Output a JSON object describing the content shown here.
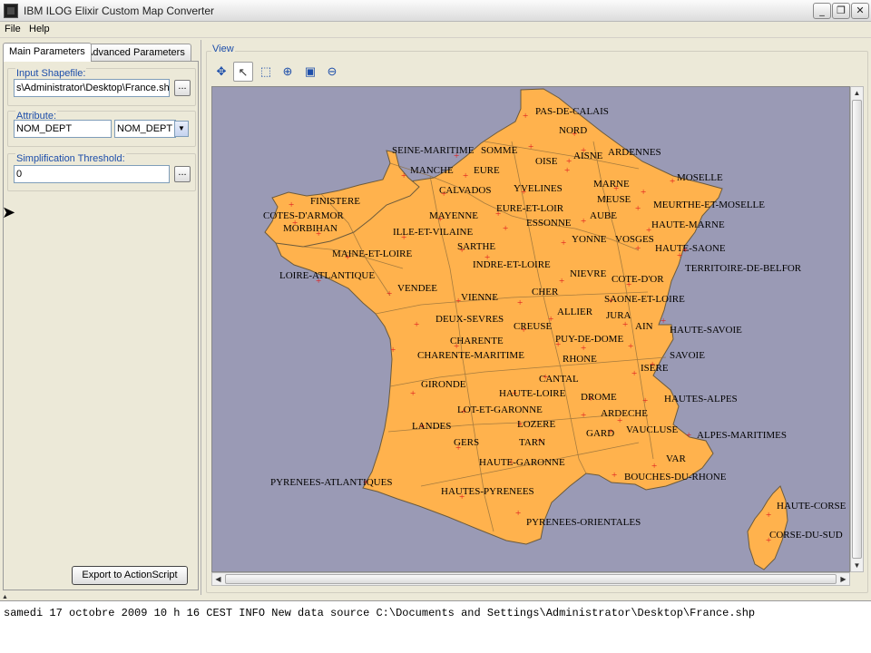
{
  "window": {
    "title": "IBM ILOG Elixir Custom Map Converter",
    "controls": {
      "minimize": "_",
      "maximize": "❐",
      "close": "✕"
    }
  },
  "menubar": {
    "items": [
      "File",
      "Help"
    ]
  },
  "left_panel": {
    "tabs": [
      "Main Parameters",
      "Advanced Parameters"
    ],
    "input_shapefile": {
      "label": "Input Shapefile:",
      "value": "s\\Administrator\\Desktop\\France.shp",
      "browse_label": "..."
    },
    "attribute": {
      "label": "Attribute:",
      "value": "NOM_DEPT",
      "selected_option": "NOM_DEPT"
    },
    "simplification": {
      "label": "Simplification Threshold:",
      "value": "0",
      "browse_label": "..."
    },
    "export_button": "Export to ActionScript"
  },
  "view": {
    "title": "View",
    "toolbar": [
      "pan-icon",
      "select-icon",
      "zoom-box-icon",
      "zoom-in-icon",
      "zoom-fit-icon",
      "zoom-out-icon"
    ],
    "map_colors": {
      "background": "#9a9ab5",
      "land": "#ffb24d",
      "border": "#6b5a3c",
      "marker": "#e02020"
    },
    "department_labels": [
      "PAS-DE-CALAIS",
      "NORD",
      "SOMME",
      "SEINE-MARITIME",
      "AISNE",
      "ARDENNES",
      "OISE",
      "MANCHE",
      "EURE",
      "YVELINES",
      "MARNE",
      "MOSELLE",
      "FINISTERE",
      "CALVADOS",
      "MEUSE",
      "MEURTHE-ET-MOSELLE",
      "COTES-D'ARMOR",
      "MAYENNE",
      "EURE-ET-LOIR",
      "AUBE",
      "HAUTE-MARNE",
      "MORBIHAN",
      "ILLE-ET-VILAINE",
      "ESSONNE",
      "YONNE",
      "VOSGES",
      "SARTHE",
      "HAUTE-SAONE",
      "MAINE-ET-LOIRE",
      "INDRE-ET-LOIRE",
      "TERRITOIRE-DE-BELFOR",
      "LOIRE-ATLANTIQUE",
      "NIEVRE",
      "COTE-D'OR",
      "VENDEE",
      "VIENNE",
      "CHER",
      "SAONE-ET-LOIRE",
      "ALLIER",
      "JURA",
      "DEUX-SEVRES",
      "CREUSE",
      "AIN",
      "HAUTE-SAVOIE",
      "CHARENTE",
      "PUY-DE-DOME",
      "CHARENTE-MARITIME",
      "SAVOIE",
      "RHONE",
      "ISERE",
      "CANTAL",
      "GIRONDE",
      "HAUTE-LOIRE",
      "DROME",
      "HAUTES-ALPES",
      "LOT-ET-GARONNE",
      "ARDECHE",
      "LANDES",
      "LOZERE",
      "VAUCLUSE",
      "ALPES-MARITIMES",
      "GARD",
      "GERS",
      "TARN",
      "VAR",
      "HAUTE-GARONNE",
      "BOUCHES-DU-RHONE",
      "PYRENEES-ATLANTIQUES",
      "HAUTES-PYRENEES",
      "HAUTE-CORSE",
      "CORSE-DU-SUD",
      "PYRENEES-ORIENTALES"
    ]
  },
  "log": {
    "line": "samedi 17 octobre 2009 10 h 16 CEST INFO New data source C:\\Documents and Settings\\Administrator\\Desktop\\France.shp"
  }
}
